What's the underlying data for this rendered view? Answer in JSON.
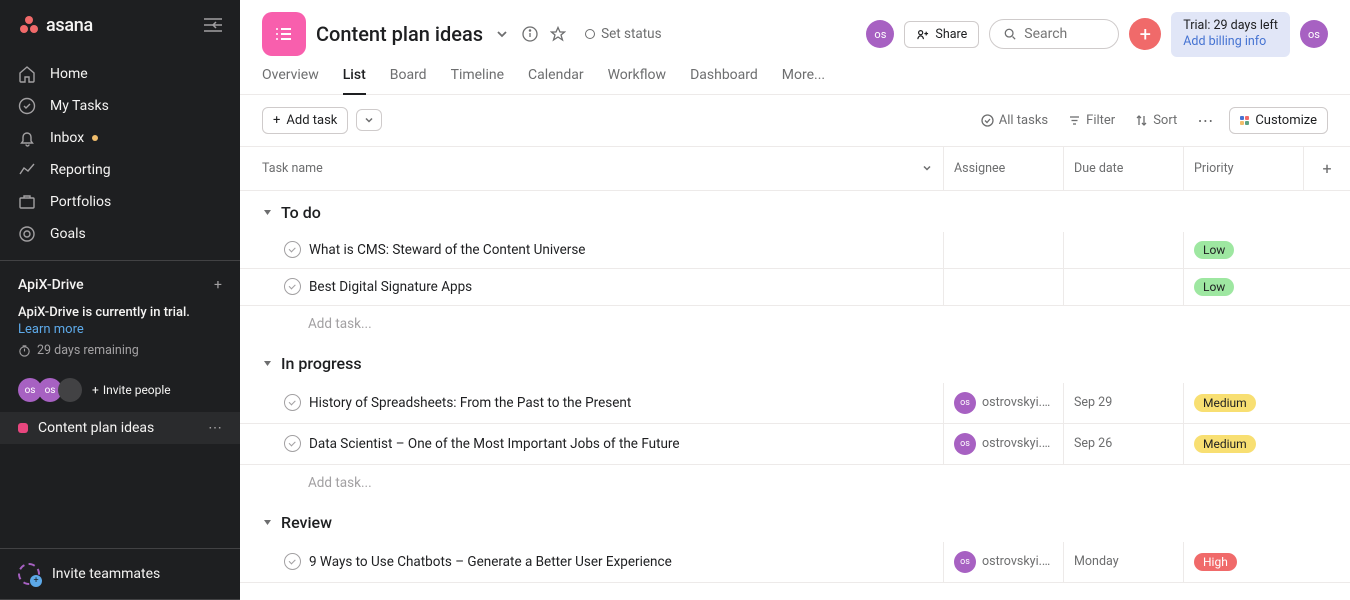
{
  "app_name": "asana",
  "sidebar": {
    "nav": [
      {
        "label": "Home",
        "icon": "home"
      },
      {
        "label": "My Tasks",
        "icon": "check-circle"
      },
      {
        "label": "Inbox",
        "icon": "bell",
        "unread": true
      },
      {
        "label": "Reporting",
        "icon": "chart"
      },
      {
        "label": "Portfolios",
        "icon": "briefcase"
      },
      {
        "label": "Goals",
        "icon": "target"
      }
    ],
    "workspace": "ApiX-Drive",
    "trial": {
      "message": "ApiX-Drive is currently in trial.",
      "link": "Learn more",
      "remaining": "29 days remaining"
    },
    "invite_people": "Invite people",
    "project": "Content plan ideas",
    "invite_teammates": "Invite teammates"
  },
  "header": {
    "title": "Content plan ideas",
    "set_status": "Set status",
    "share": "Share",
    "search_placeholder": "Search",
    "trial_badge_line1": "Trial: 29 days left",
    "trial_badge_link": "Add billing info",
    "avatar_initials": "os"
  },
  "tabs": [
    "Overview",
    "List",
    "Board",
    "Timeline",
    "Calendar",
    "Workflow",
    "Dashboard",
    "More..."
  ],
  "active_tab": "List",
  "toolbar": {
    "add_task": "Add task",
    "all_tasks": "All tasks",
    "filter": "Filter",
    "sort": "Sort",
    "customize": "Customize"
  },
  "columns": {
    "task_name": "Task name",
    "assignee": "Assignee",
    "due_date": "Due date",
    "priority": "Priority"
  },
  "sections": [
    {
      "name": "To do",
      "tasks": [
        {
          "name": "What is CMS: Steward of the Content Universe",
          "assignee": "",
          "due_date": "",
          "priority": "Low"
        },
        {
          "name": "Best Digital Signature Apps",
          "assignee": "",
          "due_date": "",
          "priority": "Low"
        }
      ]
    },
    {
      "name": "In progress",
      "tasks": [
        {
          "name": "History of Spreadsheets: From the Past to the Present",
          "assignee": "ostrovskyi.s...",
          "due_date": "Sep 29",
          "priority": "Medium"
        },
        {
          "name": "Data Scientist – One of the Most Important Jobs of the Future",
          "assignee": "ostrovskyi.s...",
          "due_date": "Sep 26",
          "priority": "Medium"
        }
      ]
    },
    {
      "name": "Review",
      "tasks": [
        {
          "name": "9 Ways to Use Chatbots – Generate a Better User Experience",
          "assignee": "ostrovskyi.s...",
          "due_date": "Monday",
          "priority": "High"
        }
      ]
    }
  ],
  "add_task_placeholder": "Add task..."
}
